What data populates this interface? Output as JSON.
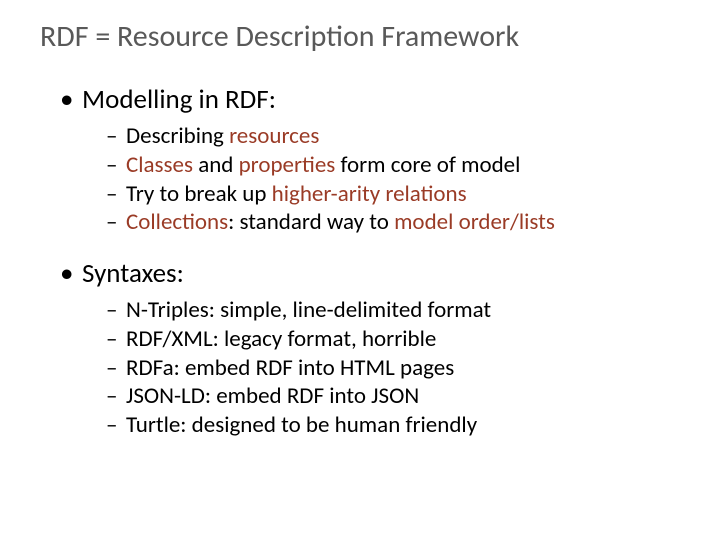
{
  "title": "RDF = Resource Description Framework",
  "section1": {
    "heading": "Modelling in RDF:",
    "items": {
      "i0_a": "Describing ",
      "i0_b": "resources",
      "i1_a": "Classes",
      "i1_b": " and ",
      "i1_c": "properties",
      "i1_d": " form core of model",
      "i2_a": "Try to break up ",
      "i2_b": "higher-arity relations",
      "i3_a": "Collections",
      "i3_b": ": standard way to ",
      "i3_c": "model order/lists"
    }
  },
  "section2": {
    "heading": "Syntaxes:",
    "items": {
      "i0": "N-Triples: simple, line-delimited format",
      "i1": "RDF/XML: legacy format, horrible",
      "i2": "RDFa: embed RDF into HTML pages",
      "i3": "JSON-LD: embed RDF into JSON",
      "i4": "Turtle: designed to be human friendly"
    }
  }
}
